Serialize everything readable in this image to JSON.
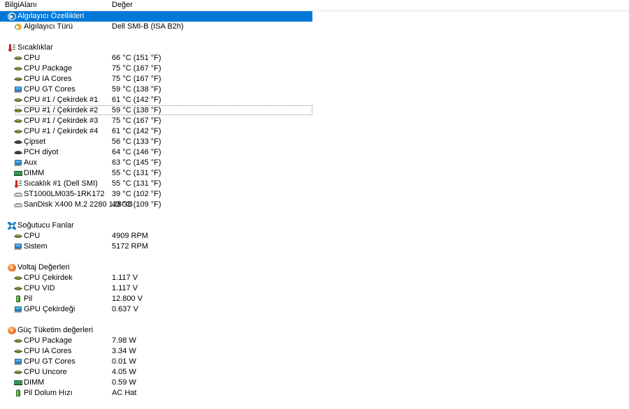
{
  "header": {
    "col_field": "BilgiAlanı",
    "col_value": "Değer"
  },
  "colors": {
    "selection": "#0078d7",
    "selection_text": "#ffffff",
    "background": "#ffffff",
    "text": "#000000",
    "grid_rule": "#e3e3e3"
  },
  "rows": [
    {
      "level": 0,
      "icon": "sensor-icon",
      "label": "Algılayıcı Özellikleri",
      "value": "",
      "selected": true,
      "focused": false
    },
    {
      "level": 1,
      "icon": "sensor-icon",
      "label": "Algılayıcı Türü",
      "value": "Dell SMI-B  (ISA B2h)",
      "selected": false,
      "focused": false
    },
    {
      "level": 0,
      "icon": "spacer",
      "label": "",
      "value": "",
      "selected": false,
      "focused": false
    },
    {
      "level": 0,
      "icon": "thermometer-icon",
      "label": "Sıcaklıklar",
      "value": "",
      "selected": false,
      "focused": false
    },
    {
      "level": 1,
      "icon": "cpu-icon",
      "label": "CPU",
      "value": "66 °C  (151 °F)",
      "selected": false,
      "focused": false
    },
    {
      "level": 1,
      "icon": "cpu-icon",
      "label": "CPU Package",
      "value": "75 °C  (167 °F)",
      "selected": false,
      "focused": false
    },
    {
      "level": 1,
      "icon": "cpu-icon",
      "label": "CPU IA Cores",
      "value": "75 °C  (167 °F)",
      "selected": false,
      "focused": false
    },
    {
      "level": 1,
      "icon": "gpu-icon",
      "label": "CPU GT Cores",
      "value": "59 °C  (138 °F)",
      "selected": false,
      "focused": false
    },
    {
      "level": 1,
      "icon": "cpu-icon",
      "label": "CPU #1 / Çekirdek #1",
      "value": "61 °C  (142 °F)",
      "selected": false,
      "focused": false
    },
    {
      "level": 1,
      "icon": "cpu-icon",
      "label": "CPU #1 / Çekirdek #2",
      "value": "59 °C  (138 °F)",
      "selected": false,
      "focused": true
    },
    {
      "level": 1,
      "icon": "cpu-icon",
      "label": "CPU #1 / Çekirdek #3",
      "value": "75 °C  (167 °F)",
      "selected": false,
      "focused": false
    },
    {
      "level": 1,
      "icon": "cpu-icon",
      "label": "CPU #1 / Çekirdek #4",
      "value": "61 °C  (142 °F)",
      "selected": false,
      "focused": false
    },
    {
      "level": 1,
      "icon": "chipset-icon",
      "label": "Çipset",
      "value": "56 °C  (133 °F)",
      "selected": false,
      "focused": false
    },
    {
      "level": 1,
      "icon": "chipset-icon",
      "label": "PCH diyot",
      "value": "64 °C  (146 °F)",
      "selected": false,
      "focused": false
    },
    {
      "level": 1,
      "icon": "gpu-icon",
      "label": "Aux",
      "value": "63 °C  (145 °F)",
      "selected": false,
      "focused": false
    },
    {
      "level": 1,
      "icon": "dimm-icon",
      "label": "DIMM",
      "value": "55 °C  (131 °F)",
      "selected": false,
      "focused": false
    },
    {
      "level": 1,
      "icon": "thermometer-icon",
      "label": "Sıcaklık #1 (Dell SMI)",
      "value": "55 °C  (131 °F)",
      "selected": false,
      "focused": false
    },
    {
      "level": 1,
      "icon": "disk-icon",
      "label": "ST1000LM035-1RK172",
      "value": "39 °C  (102 °F)",
      "selected": false,
      "focused": false
    },
    {
      "level": 1,
      "icon": "disk-icon",
      "label": "SanDisk X400 M.2 2280 128GB",
      "value": "43 °C  (109 °F)",
      "selected": false,
      "focused": false
    },
    {
      "level": 0,
      "icon": "spacer",
      "label": "",
      "value": "",
      "selected": false,
      "focused": false
    },
    {
      "level": 0,
      "icon": "fan-icon",
      "label": "Soğutucu Fanlar",
      "value": "",
      "selected": false,
      "focused": false
    },
    {
      "level": 1,
      "icon": "cpu-icon",
      "label": "CPU",
      "value": "4909 RPM",
      "selected": false,
      "focused": false
    },
    {
      "level": 1,
      "icon": "gpu-icon",
      "label": "Sistem",
      "value": "5172 RPM",
      "selected": false,
      "focused": false
    },
    {
      "level": 0,
      "icon": "spacer",
      "label": "",
      "value": "",
      "selected": false,
      "focused": false
    },
    {
      "level": 0,
      "icon": "voltage-icon",
      "label": "Voltaj Değerleri",
      "value": "",
      "selected": false,
      "focused": false
    },
    {
      "level": 1,
      "icon": "cpu-icon",
      "label": "CPU Çekirdek",
      "value": "1.117 V",
      "selected": false,
      "focused": false
    },
    {
      "level": 1,
      "icon": "cpu-icon",
      "label": "CPU VID",
      "value": "1.117 V",
      "selected": false,
      "focused": false
    },
    {
      "level": 1,
      "icon": "battery-icon",
      "label": "Pil",
      "value": "12.800 V",
      "selected": false,
      "focused": false
    },
    {
      "level": 1,
      "icon": "gpu-icon",
      "label": "GPU Çekirdeği",
      "value": "0.637 V",
      "selected": false,
      "focused": false
    },
    {
      "level": 0,
      "icon": "spacer",
      "label": "",
      "value": "",
      "selected": false,
      "focused": false
    },
    {
      "level": 0,
      "icon": "voltage-icon",
      "label": "Güç Tüketim değerleri",
      "value": "",
      "selected": false,
      "focused": false
    },
    {
      "level": 1,
      "icon": "cpu-icon",
      "label": "CPU Package",
      "value": "7.98 W",
      "selected": false,
      "focused": false
    },
    {
      "level": 1,
      "icon": "cpu-icon",
      "label": "CPU IA Cores",
      "value": "3.34 W",
      "selected": false,
      "focused": false
    },
    {
      "level": 1,
      "icon": "gpu-icon",
      "label": "CPU GT Cores",
      "value": "0.01 W",
      "selected": false,
      "focused": false
    },
    {
      "level": 1,
      "icon": "cpu-icon",
      "label": "CPU Uncore",
      "value": "4.05 W",
      "selected": false,
      "focused": false
    },
    {
      "level": 1,
      "icon": "dimm-icon",
      "label": "DIMM",
      "value": "0.59 W",
      "selected": false,
      "focused": false
    },
    {
      "level": 1,
      "icon": "battery-icon",
      "label": "Pil Dolum Hızı",
      "value": "AC Hat",
      "selected": false,
      "focused": false
    }
  ]
}
